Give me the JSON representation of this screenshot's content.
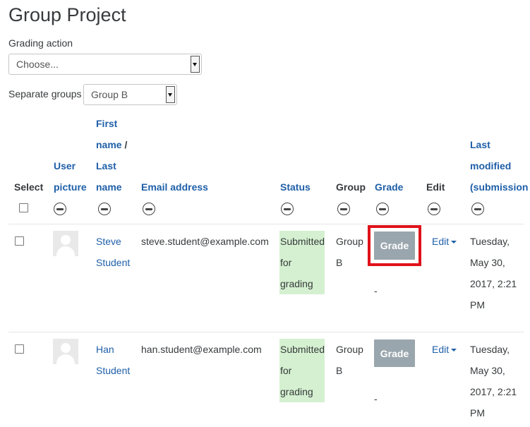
{
  "page": {
    "title": "Group Project"
  },
  "grading_action": {
    "label": "Grading action",
    "selected": "Choose..."
  },
  "separate_groups": {
    "label": "Separate groups",
    "selected": "Group B"
  },
  "columns": {
    "select": "Select",
    "user_picture": [
      "User",
      "picture"
    ],
    "name": [
      "First",
      "name",
      "/",
      "Last",
      "name"
    ],
    "email": "Email address",
    "status": "Status",
    "group": "Group",
    "grade": "Grade",
    "edit": "Edit",
    "last_modified": [
      "Last",
      "modified",
      "(submission"
    ]
  },
  "rows": [
    {
      "first_name": "Steve",
      "last_name": "Student",
      "email": "steve.student@example.com",
      "status": [
        "Submitted",
        "for",
        "grading"
      ],
      "group": [
        "Group",
        "B"
      ],
      "grade_button": "Grade",
      "grade_value": "-",
      "edit": "Edit",
      "last_modified": [
        "Tuesday,",
        "May 30,",
        "2017, 2:21",
        "PM"
      ]
    },
    {
      "first_name": "Han",
      "last_name": "Student",
      "email": "han.student@example.com",
      "status": [
        "Submitted",
        "for",
        "grading"
      ],
      "group": [
        "Group",
        "B"
      ],
      "grade_button": "Grade",
      "grade_value": "-",
      "edit": "Edit",
      "last_modified": [
        "Tuesday,",
        "May 30,",
        "2017, 2:21",
        "PM"
      ]
    }
  ],
  "colors": {
    "link": "#1f5fa8",
    "status_bg": "#d4f0d0",
    "grade_button": "#9aa6ad",
    "highlight": "#e0121a"
  }
}
